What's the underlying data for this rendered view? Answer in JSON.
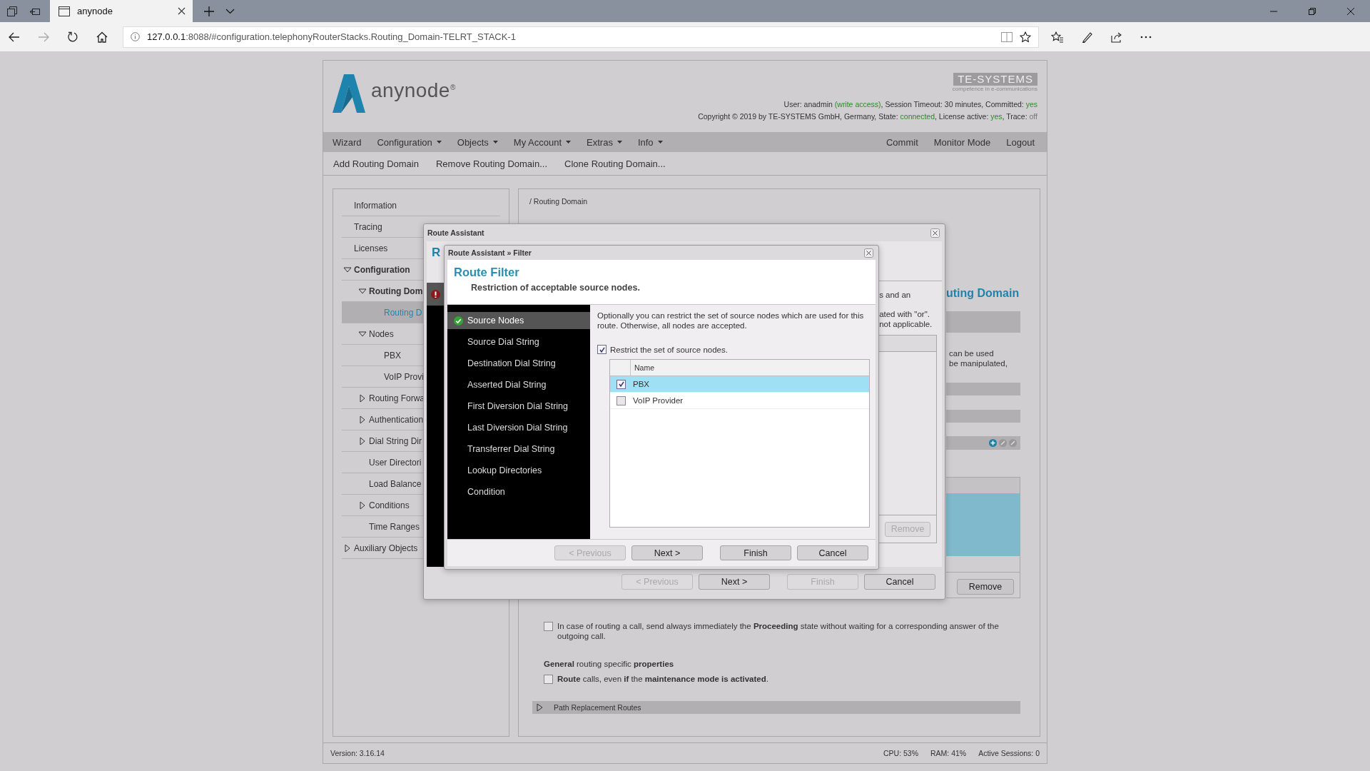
{
  "browser": {
    "tab_title": "anynode",
    "url_host": "127.0.0.1",
    "url_rest": ":8088/#configuration.telephonyRouterStacks.Routing_Domain-TELRT_STACK-1"
  },
  "header": {
    "logo": "anynode$^{®}$",
    "brand": "TE-SYSTEMS",
    "tagline": "competence in e-communications",
    "status_lines": [
      [
        {
          "text": "User: anadmin ",
          "kind": "plain"
        },
        {
          "text": "(write access)",
          "kind": "ok"
        },
        {
          "text": ", Session Timeout: 30 minutes, Committed: ",
          "kind": "plain"
        },
        {
          "text": "yes",
          "kind": "ok"
        }
      ],
      [
        {
          "text": "Copyright © 2019 by TE-SYSTEMS GmbH, Germany, State: ",
          "kind": "plain"
        },
        {
          "text": "connected",
          "kind": "ok"
        },
        {
          "text": ", License active: ",
          "kind": "plain"
        },
        {
          "text": "yes",
          "kind": "ok"
        },
        {
          "text": ", Trace: ",
          "kind": "plain"
        },
        {
          "text": "off",
          "kind": "off"
        }
      ]
    ]
  },
  "menu": [
    {
      "label": "Wizard",
      "dropdown": false
    },
    {
      "label": "Configuration",
      "dropdown": true
    },
    {
      "label": "Objects",
      "dropdown": true
    },
    {
      "label": "My Account",
      "dropdown": true
    },
    {
      "label": "Extras",
      "dropdown": true
    },
    {
      "label": "Info",
      "dropdown": true
    }
  ],
  "menu_right": [
    "Commit",
    "Monitor Mode",
    "Logout"
  ],
  "toolbar": [
    "Add Routing Domain",
    "Remove Routing Domain...",
    "Clone Routing Domain..."
  ],
  "sidebar": {
    "items": [
      {
        "label": "Information",
        "selected": false
      },
      {
        "label": "Tracing",
        "selected": false
      },
      {
        "label": "Licenses",
        "selected": false
      },
      {
        "label": "Configuration",
        "selected": false,
        "expanded": true,
        "children": [
          {
            "label": "Routing Dom",
            "selected": false,
            "expanded": true,
            "children": [
              {
                "label": "Routing D",
                "selected": true
              }
            ]
          },
          {
            "label": "Nodes",
            "selected": false,
            "expanded": true,
            "children": [
              {
                "label": "PBX",
                "selected": false
              },
              {
                "label": "VoIP Provi",
                "selected": false
              }
            ]
          },
          {
            "label": "Routing Forwa",
            "selected": false,
            "expanded": false
          },
          {
            "label": "Authentication",
            "selected": false,
            "expanded": false
          },
          {
            "label": "Dial String Dir",
            "selected": false,
            "expanded": false
          },
          {
            "label": "User Directori",
            "selected": false
          },
          {
            "label": "Load Balance",
            "selected": false
          },
          {
            "label": "Conditions",
            "selected": false,
            "expanded": false
          },
          {
            "label": "Time Ranges",
            "selected": false
          }
        ]
      },
      {
        "label": "Auxiliary Objects",
        "selected": false,
        "expanded": false
      }
    ]
  },
  "breadcrumb": "/ Routing Domain",
  "background": {
    "heading": "uting Domain",
    "lines": [
      "can be used",
      "be manipulated,"
    ],
    "button": "Remove"
  },
  "options": [
    {
      "kind": "checkbox",
      "checked": false,
      "text": "In case of routing a call, send always immediately the **Proceeding** state without waiting for a corresponding answer of the outgoing call."
    },
    {
      "kind": "heading",
      "text": "**General** routing specific **properties**"
    },
    {
      "kind": "checkbox",
      "checked": false,
      "text": "**Route** calls, even **if** the **maintenance mode is activated**."
    }
  ],
  "section_bar": {
    "label": "Path Replacement Routes",
    "expanded": false
  },
  "footer": {
    "version": "Version: 3.16.14",
    "cpu": "CPU: 53%",
    "ram": "RAM: 41%",
    "sessions": "Active Sessions: 0"
  },
  "route_assistant": {
    "title": "Route Assistant",
    "heading": "R",
    "fragments": [
      "s and an",
      "ated with \"or\".",
      "not applicable."
    ],
    "list_button": {
      "label": "Remove",
      "disabled": true
    },
    "buttons": [
      {
        "label": "< Previous",
        "disabled": true
      },
      {
        "label": "Next >",
        "disabled": false
      },
      {
        "label": "Finish",
        "disabled": true
      },
      {
        "label": "Cancel",
        "disabled": false
      }
    ]
  },
  "filter_dialog": {
    "title": "Route Assistant » Filter",
    "heading": "Route Filter",
    "subheading": "Restriction of acceptable source nodes.",
    "steps": [
      {
        "label": "Source Nodes",
        "selected": true
      },
      {
        "label": "Source Dial String",
        "selected": false
      },
      {
        "label": "Destination Dial String",
        "selected": false
      },
      {
        "label": "Asserted Dial String",
        "selected": false
      },
      {
        "label": "First Diversion Dial String",
        "selected": false
      },
      {
        "label": "Last Diversion Dial String",
        "selected": false
      },
      {
        "label": "Transferrer Dial String",
        "selected": false
      },
      {
        "label": "Lookup Directories",
        "selected": false
      },
      {
        "label": "Condition",
        "selected": false
      }
    ],
    "description": "Optionally you can restrict the set of source nodes which are used for this route. Otherwise, all nodes are accepted.",
    "restrict": {
      "label": "Restrict the set of source nodes.",
      "checked": true
    },
    "list": {
      "column": "Name",
      "rows": [
        {
          "name": "PBX",
          "checked": true,
          "selected": true
        },
        {
          "name": "VoIP Provider",
          "checked": false,
          "selected": false
        }
      ]
    },
    "buttons": [
      {
        "label": "< Previous",
        "disabled": true
      },
      {
        "label": "Next >",
        "disabled": false
      },
      {
        "label": "Finish",
        "disabled": false
      },
      {
        "label": "Cancel",
        "disabled": false
      }
    ]
  }
}
